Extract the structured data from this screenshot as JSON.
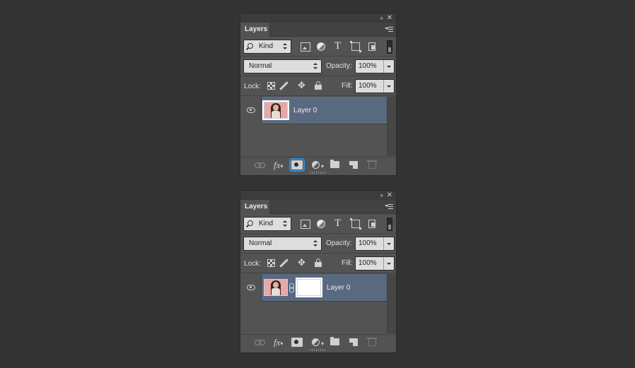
{
  "panels": [
    {
      "id": "before",
      "tab_label": "Layers",
      "filter": {
        "kind_label": "Kind"
      },
      "blend_mode": "Normal",
      "opacity_label": "Opacity:",
      "opacity_value": "100%",
      "lock_label": "Lock:",
      "fill_label": "Fill:",
      "fill_value": "100%",
      "layer": {
        "name": "Layer 0",
        "has_mask": false
      },
      "add_mask_button_highlighted": true
    },
    {
      "id": "after",
      "tab_label": "Layers",
      "filter": {
        "kind_label": "Kind"
      },
      "blend_mode": "Normal",
      "opacity_label": "Opacity:",
      "opacity_value": "100%",
      "lock_label": "Lock:",
      "fill_label": "Fill:",
      "fill_value": "100%",
      "layer": {
        "name": "Layer 0",
        "has_mask": true
      },
      "add_mask_button_highlighted": false
    }
  ],
  "icons": {
    "collapse": "«",
    "close": "✕",
    "type_filter": "T",
    "move_lock": "✥",
    "fx": "fx",
    "fx_dot": "▾",
    "adj_dot": "▾"
  },
  "colors": {
    "background": "#333333",
    "panel": "#535353",
    "selected_layer": "#596980",
    "mask_highlight": "#2c8fe0"
  }
}
